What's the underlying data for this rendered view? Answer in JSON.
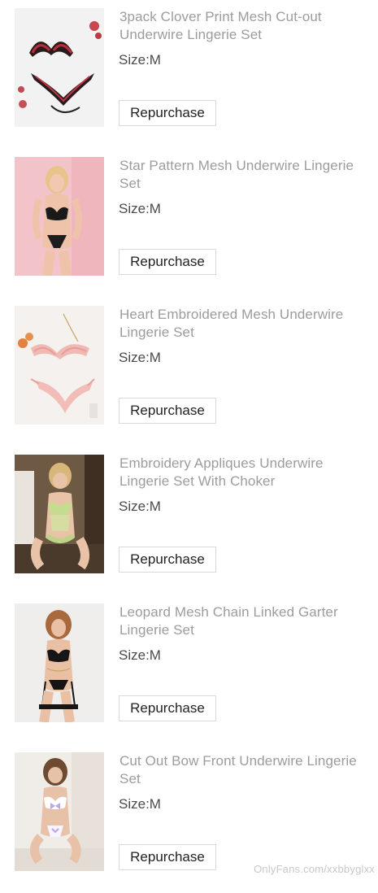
{
  "orders": [
    {
      "title": "3pack Clover Print Mesh Cut-out Underwire Lingerie Set",
      "size": "Size:M",
      "action": "Repurchase",
      "image": "black-red-floral-lingerie-flatlay"
    },
    {
      "title": "Star Pattern Mesh Underwire Lingerie Set",
      "size": "Size:M",
      "action": "Repurchase",
      "image": "model-black-lace-lingerie-pink-background"
    },
    {
      "title": "Heart Embroidered Mesh Underwire Lingerie Set",
      "size": "Size:M",
      "action": "Repurchase",
      "image": "pink-embroidered-lingerie-flatlay"
    },
    {
      "title": "Embroidery Appliques Underwire Lingerie Set With Choker",
      "size": "Size:M",
      "action": "Repurchase",
      "image": "model-green-appliques-lingerie"
    },
    {
      "title": "Leopard Mesh Chain Linked Garter Lingerie Set",
      "size": "Size:M",
      "action": "Repurchase",
      "image": "model-black-garter-lingerie-chain"
    },
    {
      "title": "Cut Out Bow Front Underwire Lingerie Set",
      "size": "Size:M",
      "action": "Repurchase",
      "image": "model-white-bow-lingerie"
    }
  ],
  "watermark": "OnlyFans.com/xxbbyglxx",
  "colors": {
    "title": "#9c9c9c",
    "size": "#4a4a4a",
    "button_border": "#d9d9d9"
  }
}
